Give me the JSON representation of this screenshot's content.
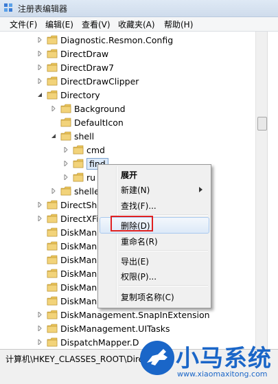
{
  "window": {
    "title": "注册表编辑器"
  },
  "menu": [
    "文件(F)",
    "编辑(E)",
    "查看(V)",
    "收藏夹(A)",
    "帮助(H)"
  ],
  "tree": [
    {
      "label": "Diagnostic.Resmon.Config",
      "level": 0,
      "expander": "collapsed"
    },
    {
      "label": "DirectDraw",
      "level": 0,
      "expander": "collapsed"
    },
    {
      "label": "DirectDraw7",
      "level": 0,
      "expander": "collapsed"
    },
    {
      "label": "DirectDrawClipper",
      "level": 0,
      "expander": "collapsed"
    },
    {
      "label": "Directory",
      "level": 0,
      "expander": "expanded"
    },
    {
      "label": "Background",
      "level": 1,
      "expander": "collapsed"
    },
    {
      "label": "DefaultIcon",
      "level": 1,
      "expander": "none"
    },
    {
      "label": "shell",
      "level": 1,
      "expander": "expanded"
    },
    {
      "label": "cmd",
      "level": 2,
      "expander": "collapsed"
    },
    {
      "label": "find",
      "level": 2,
      "expander": "collapsed",
      "selected": true
    },
    {
      "label": "ru",
      "level": 2,
      "expander": "collapsed"
    },
    {
      "label": "shelle",
      "level": 1,
      "expander": "collapsed"
    },
    {
      "label": "DirectSho",
      "level": 0,
      "expander": "collapsed"
    },
    {
      "label": "DirectXFi",
      "level": 0,
      "expander": "collapsed"
    },
    {
      "label": "DiskMan",
      "level": 0,
      "expander": "none"
    },
    {
      "label": "DiskMan",
      "level": 0,
      "expander": "none"
    },
    {
      "label": "DiskMan",
      "level": 0,
      "expander": "none"
    },
    {
      "label": "DiskMan",
      "level": 0,
      "expander": "none"
    },
    {
      "label": "DiskMan",
      "level": 0,
      "expander": "none"
    },
    {
      "label": "DiskMan",
      "level": 0,
      "expander": "none"
    },
    {
      "label": "DiskManagement.SnapInExtension",
      "level": 0,
      "expander": "collapsed"
    },
    {
      "label": "DiskManagement.UITasks",
      "level": 0,
      "expander": "collapsed"
    },
    {
      "label": "DispatchMapper.D",
      "level": 0,
      "expander": "collapsed"
    }
  ],
  "context_menu": {
    "items": [
      "展开",
      "新建(N)",
      "查找(F)...",
      "删除(D)",
      "重命名(R)",
      "导出(E)",
      "权限(P)...",
      "复制项名称(C)"
    ],
    "highlighted": "删除(D)"
  },
  "status": {
    "path": "计算机\\HKEY_CLASSES_ROOT\\Dire"
  },
  "watermark": {
    "brand": "小马系统",
    "url": "www.xiaomaxitong.com"
  },
  "colors": {
    "folder": "#e8c25a",
    "highlight_box": "#e02020",
    "brand": "#1a66c8"
  }
}
